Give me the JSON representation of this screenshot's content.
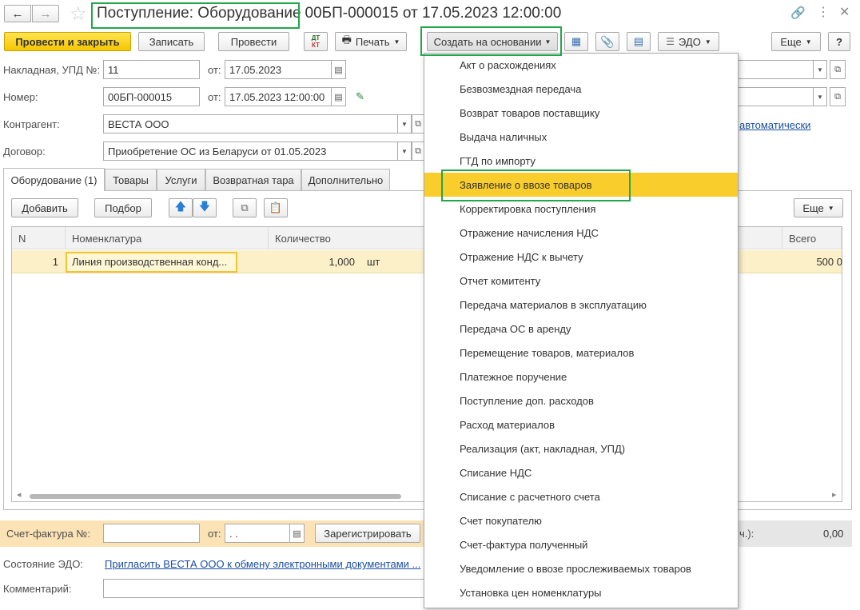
{
  "window": {
    "title_part1": "Поступление: Оборудование",
    "title_part2": "00БП-000015 от 17.05.2023 12:00:00"
  },
  "toolbar": {
    "post_close": "Провести и закрыть",
    "save": "Записать",
    "post": "Провести",
    "dtkt_top": "ДТ",
    "dtkt_bottom": "КТ",
    "print": "Печать",
    "create_based": "Создать на основании",
    "edo": "ЭДО",
    "more": "Еще",
    "help": "?"
  },
  "form": {
    "invoice_label": "Накладная, УПД №:",
    "invoice_value": "11",
    "from_label": "от:",
    "invoice_date": "17.05.2023",
    "number_label": "Номер:",
    "number_value": "00БП-000015",
    "number_date": "17.05.2023 12:00:00",
    "counterparty_label": "Контрагент:",
    "counterparty_value": "ВЕСТА ООО",
    "contract_label": "Договор:",
    "contract_value": "Приобретение ОС из Беларуси от 01.05.2023",
    "auto_link": "автоматически"
  },
  "tabs": [
    "Оборудование (1)",
    "Товары",
    "Услуги",
    "Возвратная тара",
    "Дополнительно"
  ],
  "table_toolbar": {
    "add": "Добавить",
    "pick": "Подбор",
    "more": "Еще"
  },
  "table": {
    "headers": [
      "N",
      "Номенклатура",
      "Количество",
      "Всего"
    ],
    "rows": [
      {
        "n": "1",
        "item": "Линия производственная конд...",
        "qty": "1,000",
        "unit": "шт",
        "total": "500 0"
      }
    ]
  },
  "footer": {
    "invoice_label": "Счет-фактура №:",
    "from_label": "от:",
    "date_placeholder": " .  .",
    "register": "Зарегистрировать",
    "sum_label": "ч.):",
    "sum_value": "0,00",
    "edo_label": "Состояние ЭДО:",
    "edo_link": "Пригласить ВЕСТА ООО к обмену электронными документами ...",
    "comment_label": "Комментарий:"
  },
  "menu": {
    "items": [
      "Акт о расхождениях",
      "Безвозмездная передача",
      "Возврат товаров поставщику",
      "Выдача наличных",
      "ГТД по импорту",
      "Заявление о ввозе товаров",
      "Корректировка поступления",
      "Отражение начисления НДС",
      "Отражение НДС к вычету",
      "Отчет комитенту",
      "Передача материалов в эксплуатацию",
      "Передача ОС в аренду",
      "Перемещение товаров, материалов",
      "Платежное поручение",
      "Поступление доп. расходов",
      "Расход материалов",
      "Реализация (акт, накладная, УПД)",
      "Списание НДС",
      "Списание с расчетного счета",
      "Счет покупателю",
      "Счет-фактура полученный",
      "Уведомление о ввозе прослеживаемых товаров",
      "Установка цен номенклатуры"
    ],
    "selected_index": 5
  },
  "colors": {
    "accent_yellow": "#f9cd2b",
    "highlight_green": "#21a74a",
    "link_blue": "#1a4fa0"
  }
}
